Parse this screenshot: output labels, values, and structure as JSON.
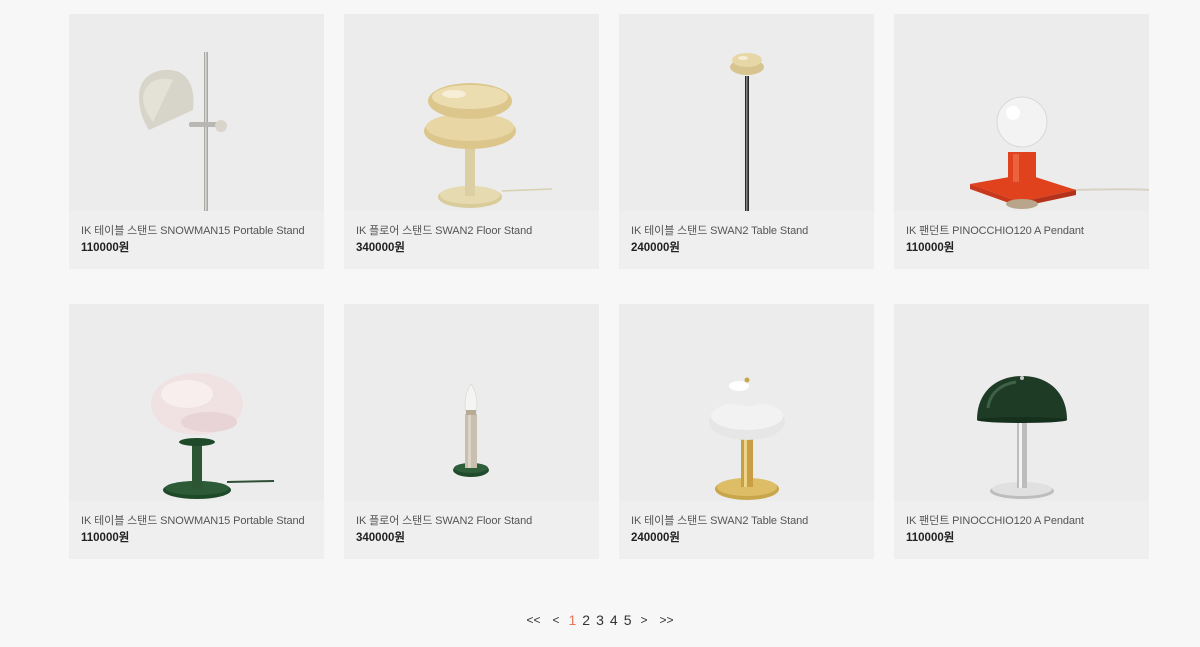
{
  "products": [
    {
      "name": "IK 테이블 스탠드 SNOWMAN15 Portable Stand",
      "price": "110000원",
      "image": "lamp-snowman-beige-icon"
    },
    {
      "name": "IK 플로어 스탠드 SWAN2 Floor Stand",
      "price": "340000원",
      "image": "lamp-swan-yellow-icon"
    },
    {
      "name": "IK 테이블 스탠드 SWAN2 Table Stand",
      "price": "240000원",
      "image": "lamp-swan-floor-pole-icon"
    },
    {
      "name": "IK 팬던트 PINOCCHIO120 A Pendant",
      "price": "110000원",
      "image": "lamp-pinocchio-orange-icon"
    },
    {
      "name": "IK 테이블 스탠드 SNOWMAN15 Portable Stand",
      "price": "110000원",
      "image": "lamp-snowman-pink-icon"
    },
    {
      "name": "IK 플로어 스탠드 SWAN2 Floor Stand",
      "price": "340000원",
      "image": "lamp-candle-icon"
    },
    {
      "name": "IK 테이블 스탠드 SWAN2 Table Stand",
      "price": "240000원",
      "image": "lamp-swan-white-gold-icon"
    },
    {
      "name": "IK 팬던트 PINOCCHIO120 A Pendant",
      "price": "110000원",
      "image": "lamp-mushroom-green-icon"
    }
  ],
  "pagination": {
    "first": "<<",
    "prev": "<",
    "pages": [
      "1",
      "2",
      "3",
      "4",
      "5"
    ],
    "active_page": "1",
    "next": ">",
    "last": ">>"
  },
  "colors": {
    "background": "#f7f7f7",
    "card": "#ececed",
    "active_page": "#e5785a"
  }
}
